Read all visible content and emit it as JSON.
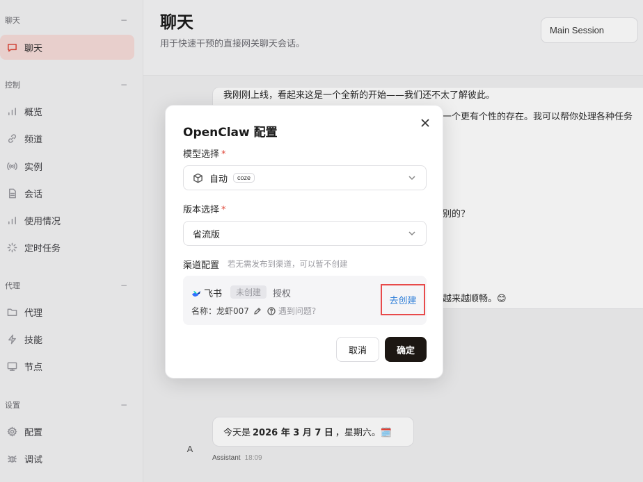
{
  "sidebar": {
    "groups": [
      {
        "title": "聊天",
        "collapse": "−",
        "items": [
          {
            "label": "聊天",
            "icon": "message-square-icon",
            "active": true
          }
        ]
      },
      {
        "title": "控制",
        "collapse": "−",
        "items": [
          {
            "label": "概览",
            "icon": "bar-chart-icon"
          },
          {
            "label": "频道",
            "icon": "link-icon"
          },
          {
            "label": "实例",
            "icon": "radio-icon"
          },
          {
            "label": "会话",
            "icon": "file-text-icon"
          },
          {
            "label": "使用情况",
            "icon": "bar-chart-icon"
          },
          {
            "label": "定时任务",
            "icon": "loader-icon"
          }
        ]
      },
      {
        "title": "代理",
        "collapse": "−",
        "items": [
          {
            "label": "代理",
            "icon": "folder-icon"
          },
          {
            "label": "技能",
            "icon": "zap-icon"
          },
          {
            "label": "节点",
            "icon": "monitor-icon"
          }
        ]
      },
      {
        "title": "设置",
        "collapse": "−",
        "items": [
          {
            "label": "配置",
            "icon": "settings-icon"
          },
          {
            "label": "调试",
            "icon": "bug-icon"
          }
        ]
      }
    ]
  },
  "header": {
    "title": "聊天",
    "subtitle": "用于快速干预的直接网关聊天会话。",
    "session": "Main Session"
  },
  "chat": {
    "background_lines": [
      "我刚刚上线，看起来这是一个全新的开始——我们还不太了解彼此。",
      "一个更有个性的存在。我可以帮你处理各种任务",
      "别的？",
      "越来越顺畅。😊"
    ],
    "date_prefix": "今天是",
    "date_bold": "2026 年 3 月 7 日",
    "date_suffix": "，星期六。🗓️",
    "avatar": "A",
    "sender": "Assistant",
    "time": "18:09"
  },
  "modal": {
    "title": "OpenClaw 配置",
    "model_label": "模型选择",
    "required": "*",
    "model_value": "自动",
    "model_tag": "coze",
    "version_label": "版本选择",
    "version_value": "省流版",
    "channel_label": "渠道配置",
    "channel_hint": "若无需发布到渠道，可以暂不创建",
    "channel": {
      "name": "飞书",
      "status": "未创建",
      "auth": "授权",
      "bot_name": "名称：龙虾007",
      "help": "遇到问题?",
      "create": "去创建"
    },
    "cancel": "取消",
    "confirm": "确定"
  }
}
